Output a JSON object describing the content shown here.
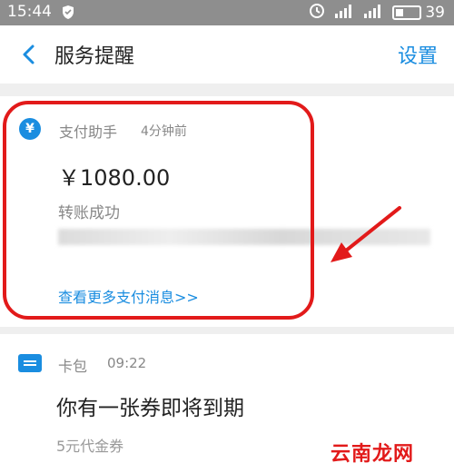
{
  "status_bar": {
    "time": "15:44",
    "battery": "39"
  },
  "nav": {
    "title": "服务提醒",
    "settings": "设置"
  },
  "card1": {
    "source": "支付助手",
    "time_ago": "4分钟前",
    "amount": "￥1080.00",
    "status": "转账成功",
    "more_link": "查看更多支付消息>>"
  },
  "card2": {
    "source": "卡包",
    "time": "09:22",
    "title": "你有一张券即将到期",
    "subtitle": "5元代金券"
  },
  "watermark": "云南龙网",
  "colors": {
    "accent": "#1a8de0",
    "highlight": "#e21a1a"
  }
}
